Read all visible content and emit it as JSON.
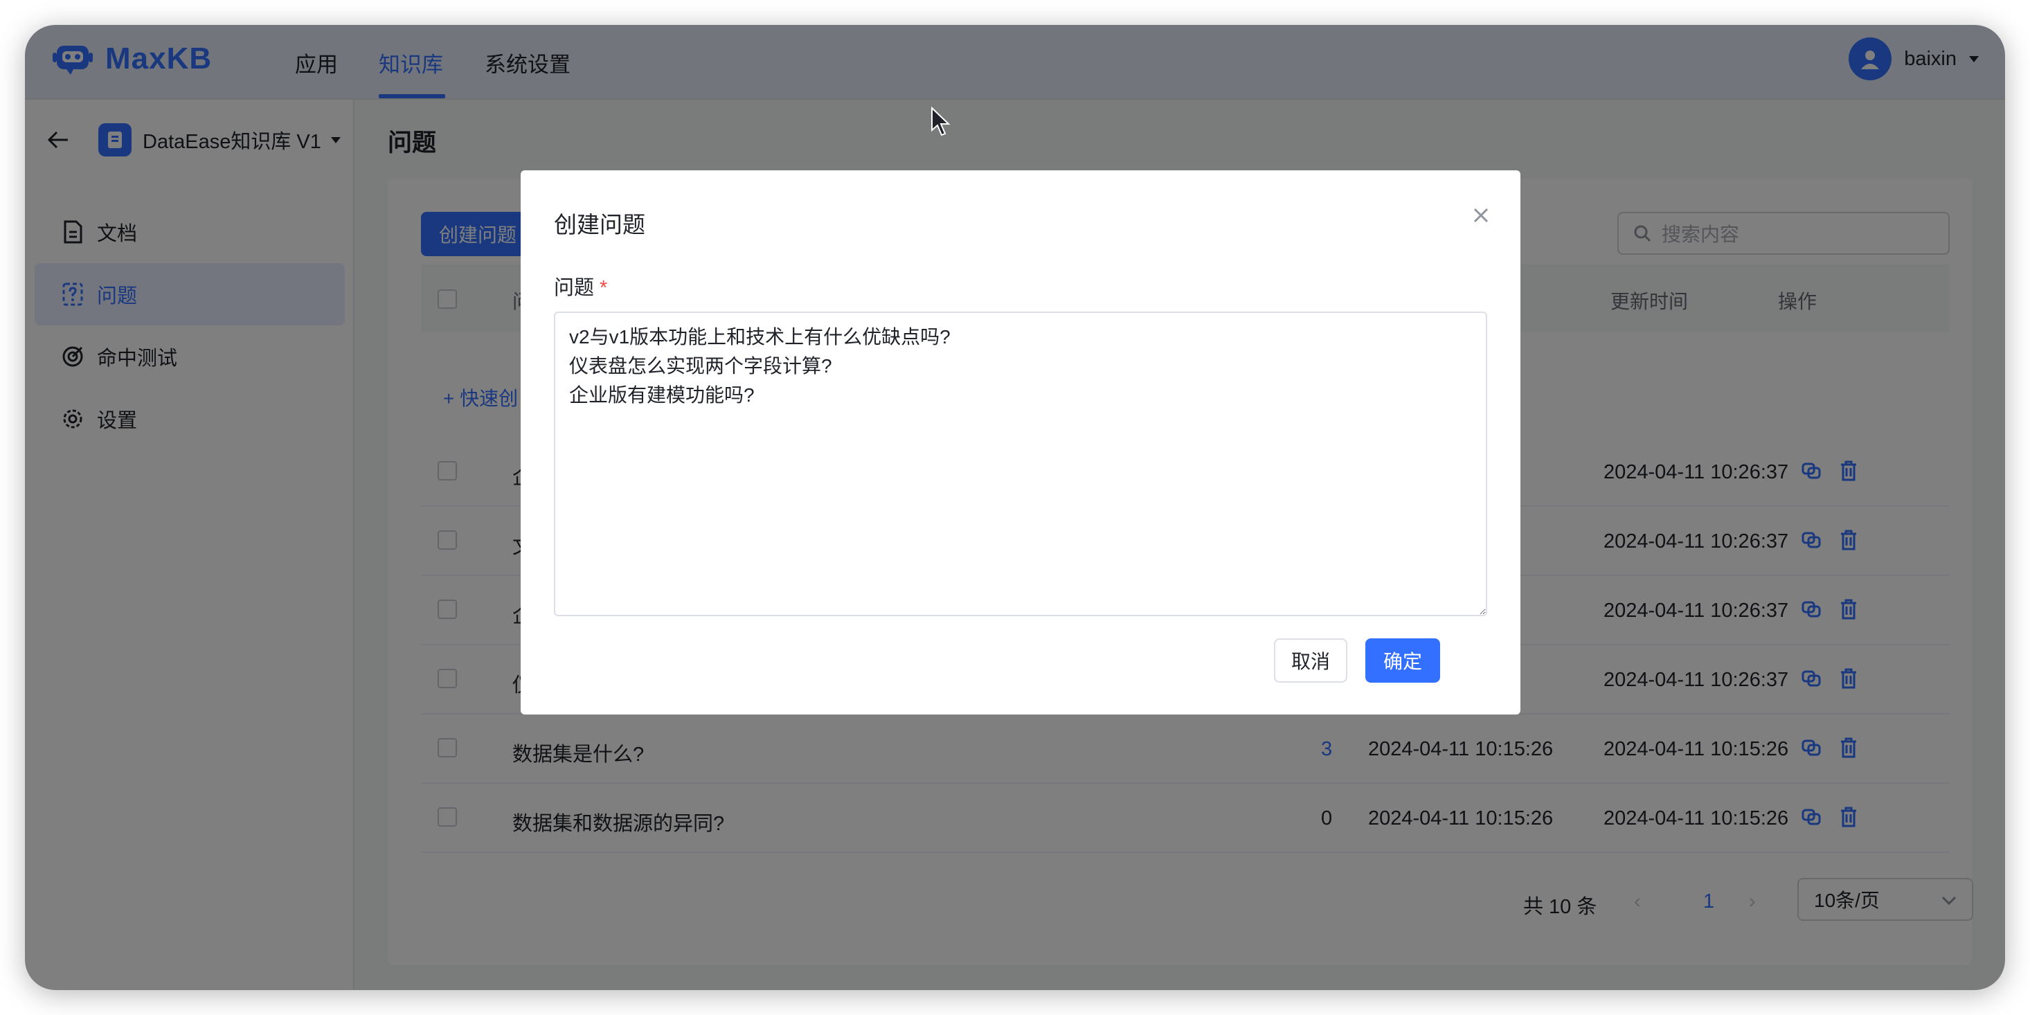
{
  "app": {
    "name": "MaxKB"
  },
  "nav": {
    "apps": "应用",
    "knowledge": "知识库",
    "settings": "系统设置"
  },
  "user": {
    "name": "baixin"
  },
  "sidebar": {
    "kb_name": "DataEase知识库 V1",
    "items": [
      {
        "label": "文档",
        "icon": "document-icon"
      },
      {
        "label": "问题",
        "icon": "question-icon"
      },
      {
        "label": "命中测试",
        "icon": "target-icon"
      },
      {
        "label": "设置",
        "icon": "gear-icon"
      }
    ]
  },
  "main": {
    "title": "问题",
    "create_button": "创建问题",
    "search_placeholder": "搜索内容",
    "quick_create": "+ 快速创",
    "columns": {
      "q": "问",
      "updated": "更新时间",
      "ops": "操作"
    },
    "rows": [
      {
        "q": "企",
        "count": "",
        "created": "",
        "updated": "2024-04-11 10:26:37"
      },
      {
        "q": "文",
        "count": "",
        "created": "",
        "updated": "2024-04-11 10:26:37"
      },
      {
        "q": "企",
        "count": "",
        "created": "",
        "updated": "2024-04-11 10:26:37"
      },
      {
        "q": "仪",
        "count": "",
        "created": "",
        "updated": "2024-04-11 10:26:37"
      },
      {
        "q": "数据集是什么?",
        "count": "3",
        "created": "2024-04-11 10:15:26",
        "updated": "2024-04-11 10:15:26"
      },
      {
        "q": "数据集和数据源的异同?",
        "count": "0",
        "created": "2024-04-11 10:15:26",
        "updated": "2024-04-11 10:15:26"
      }
    ],
    "pagination": {
      "total": "共 10 条",
      "prev": "‹",
      "current": "1",
      "next": "›",
      "page_size": "10条/页"
    }
  },
  "dialog": {
    "title": "创建问题",
    "field_label": "问题",
    "required_mark": "*",
    "value": "v2与v1版本功能上和技术上有什么优缺点吗?\n仪表盘怎么实现两个字段计算?\n企业版有建模功能吗?",
    "cancel": "取消",
    "confirm": "确定"
  },
  "colors": {
    "accent": "#3370ff",
    "required": "#f54a45"
  }
}
